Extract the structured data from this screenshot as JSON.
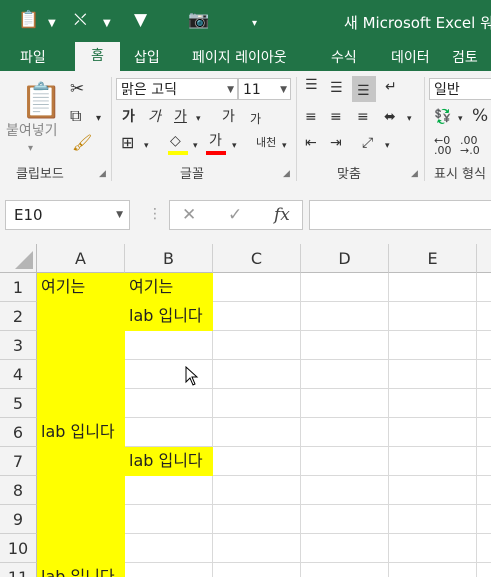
{
  "app": {
    "title": "새 Microsoft Excel 워크"
  },
  "tabs": [
    "파일",
    "홈",
    "삽입",
    "페이지 레이아웃",
    "수식",
    "데이터",
    "검토"
  ],
  "ribbon": {
    "clipboard": {
      "label": "클립보드",
      "paste_label": "붙여넣기"
    },
    "font": {
      "label": "글꼴",
      "font_name": "맑은 고딕",
      "font_size": "11",
      "bold": "가",
      "italic": "가",
      "underline": "가",
      "grow": "가",
      "shrink": "가",
      "font_color": "가",
      "phonetic": "내천"
    },
    "alignment": {
      "label": "맞춤"
    },
    "number": {
      "label": "표시 형식",
      "format": "일반",
      "percent": "%"
    }
  },
  "formula_bar": {
    "name_box": "E10",
    "fx": "fx",
    "value": ""
  },
  "columns": [
    "A",
    "B",
    "C",
    "D",
    "E"
  ],
  "rows": [
    "1",
    "2",
    "3",
    "4",
    "5",
    "6",
    "7",
    "8",
    "9",
    "10",
    "11"
  ],
  "cells": {
    "A1": "여기는",
    "B1": "여기는",
    "B2": "lab 입니다",
    "A6": "lab 입니다",
    "B7": "lab 입니다",
    "A11": "lab 입니다"
  },
  "colors": {
    "excel_green": "#217346",
    "highlight": "#ffff00"
  }
}
